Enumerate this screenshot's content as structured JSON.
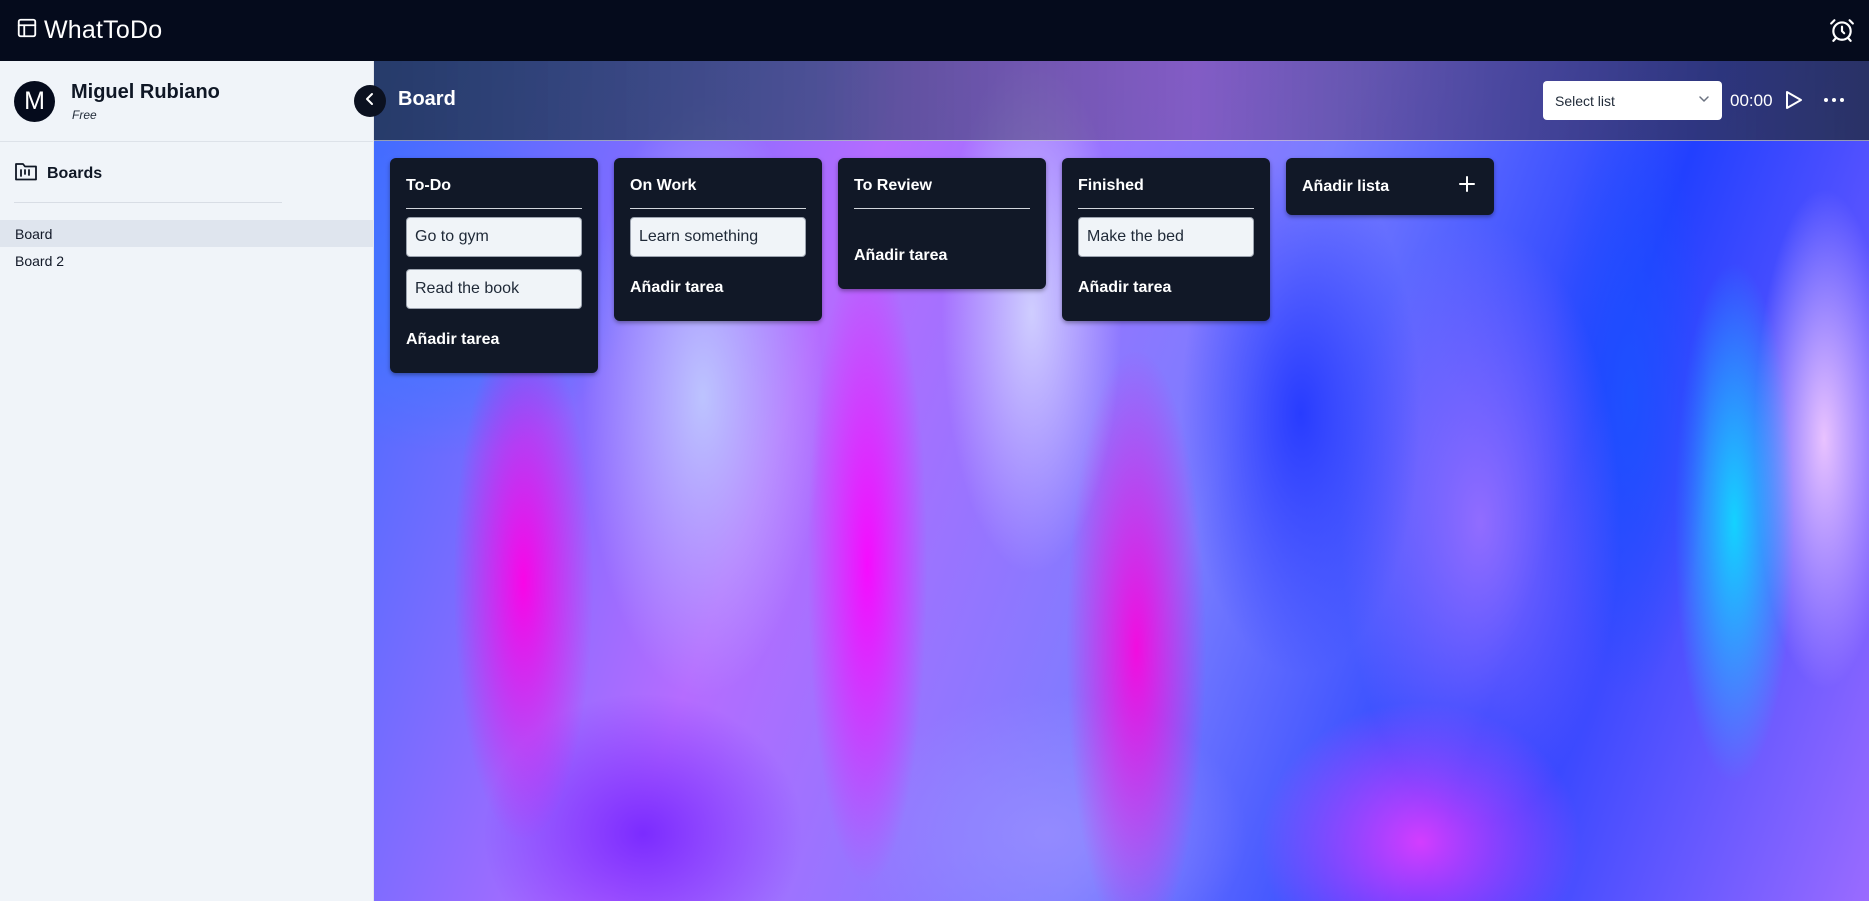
{
  "app": {
    "title": "WhatToDo",
    "logo_icon": "layout-table-icon",
    "alarm_icon": "alarm-clock-icon"
  },
  "user": {
    "initial": "M",
    "name": "Miguel Rubiano",
    "plan": "Free"
  },
  "sidebar": {
    "section_title": "Boards",
    "section_icon": "folder-board-icon",
    "collapse_icon": "chevron-left-icon",
    "boards": [
      {
        "label": "Board",
        "active": true
      },
      {
        "label": "Board 2",
        "active": false
      }
    ]
  },
  "board": {
    "title": "Board",
    "select_list": {
      "label": "Select list",
      "icon": "chevron-down-icon"
    },
    "timer": "00:00",
    "play_icon": "play-icon",
    "more_icon": "more-horizontal-icon",
    "lists": [
      {
        "title": "To-Do",
        "tasks": [
          "Go to gym",
          "Read the book"
        ],
        "add_label": "Añadir tarea"
      },
      {
        "title": "On Work",
        "tasks": [
          "Learn something"
        ],
        "add_label": "Añadir tarea"
      },
      {
        "title": "To Review",
        "tasks": [],
        "add_label": "Añadir tarea"
      },
      {
        "title": "Finished",
        "tasks": [
          "Make the bed"
        ],
        "add_label": "Añadir tarea"
      }
    ],
    "add_list": {
      "label": "Añadir lista",
      "icon": "plus-icon"
    }
  },
  "colors": {
    "topbar": "#050b1c",
    "sidebar_bg": "#f0f4f9",
    "list_bg": "#111827",
    "task_bg": "#f0f4f8"
  }
}
